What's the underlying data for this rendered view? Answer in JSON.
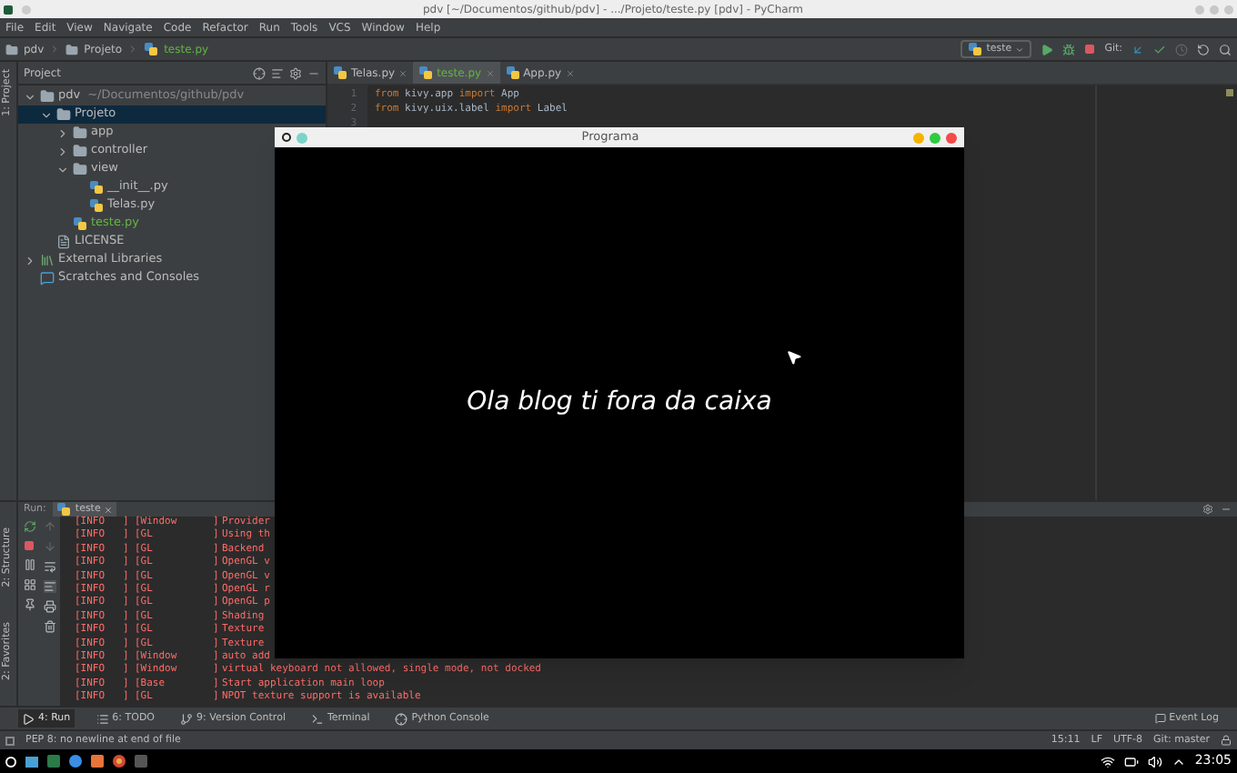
{
  "window": {
    "title": "pdv [~/Documentos/github/pdv] - .../Projeto/teste.py [pdv] - PyCharm"
  },
  "menu": [
    "File",
    "Edit",
    "View",
    "Navigate",
    "Code",
    "Refactor",
    "Run",
    "Tools",
    "VCS",
    "Window",
    "Help"
  ],
  "breadcrumb": [
    "pdv",
    "Projeto",
    "teste.py"
  ],
  "toolbar": {
    "run_config": "teste",
    "git_label": "Git:"
  },
  "left_strip": [
    "1: Project",
    "2: Structure",
    "2: Favorites"
  ],
  "project": {
    "title": "Project",
    "tree": [
      {
        "label": "pdv",
        "path": "~/Documentos/github/pdv",
        "kind": "folder",
        "expanded": true,
        "selected": false,
        "children": [
          {
            "label": "Projeto",
            "kind": "folder",
            "expanded": true,
            "selected": true,
            "children": [
              {
                "label": "app",
                "kind": "folder",
                "expanded": false,
                "selected": false
              },
              {
                "label": "controller",
                "kind": "folder",
                "expanded": false,
                "selected": false
              },
              {
                "label": "view",
                "kind": "folder",
                "expanded": true,
                "selected": false,
                "children": [
                  {
                    "label": "__init__.py",
                    "kind": "python",
                    "selected": false
                  },
                  {
                    "label": "Telas.py",
                    "kind": "python",
                    "selected": false
                  }
                ]
              },
              {
                "label": "teste.py",
                "kind": "python",
                "added": true,
                "selected": false
              }
            ]
          },
          {
            "label": "LICENSE",
            "kind": "file",
            "selected": false
          }
        ]
      },
      {
        "label": "External Libraries",
        "kind": "library",
        "expanded": false,
        "selected": false
      },
      {
        "label": "Scratches and Consoles",
        "kind": "scratch",
        "selected": false
      }
    ]
  },
  "editor": {
    "tabs": [
      {
        "label": "Telas.py",
        "selected": false
      },
      {
        "label": "teste.py",
        "selected": true
      },
      {
        "label": "App.py",
        "selected": false
      }
    ],
    "lines": [
      {
        "number": "1",
        "tokens": [
          {
            "text": "from",
            "kind": "keyword"
          },
          {
            "text": " kivy.app ",
            "kind": "plain"
          },
          {
            "text": "import",
            "kind": "keyword"
          },
          {
            "text": " App",
            "kind": "plain"
          }
        ]
      },
      {
        "number": "2",
        "tokens": [
          {
            "text": "from",
            "kind": "keyword"
          },
          {
            "text": " kivy.uix.label ",
            "kind": "plain"
          },
          {
            "text": "import",
            "kind": "keyword"
          },
          {
            "text": " Label",
            "kind": "plain"
          }
        ]
      },
      {
        "number": "3"
      }
    ]
  },
  "app_window": {
    "title": "Programa",
    "label": "Ola blog ti fora da caixa"
  },
  "run": {
    "title": "Run:",
    "tab": "teste",
    "log": [
      {
        "level": "[INFO   ]",
        "source": "[Window      ]",
        "message": "Provider"
      },
      {
        "level": "[INFO   ]",
        "source": "[GL          ]",
        "message": "Using th"
      },
      {
        "level": "[INFO   ]",
        "source": "[GL          ]",
        "message": "Backend"
      },
      {
        "level": "[INFO   ]",
        "source": "[GL          ]",
        "message": "OpenGL v"
      },
      {
        "level": "[INFO   ]",
        "source": "[GL          ]",
        "message": "OpenGL v"
      },
      {
        "level": "[INFO   ]",
        "source": "[GL          ]",
        "message": "OpenGL r"
      },
      {
        "level": "[INFO   ]",
        "source": "[GL          ]",
        "message": "OpenGL p"
      },
      {
        "level": "[INFO   ]",
        "source": "[GL          ]",
        "message": "Shading"
      },
      {
        "level": "[INFO   ]",
        "source": "[GL          ]",
        "message": "Texture"
      },
      {
        "level": "[INFO   ]",
        "source": "[GL          ]",
        "message": "Texture"
      },
      {
        "level": "[INFO   ]",
        "source": "[Window      ]",
        "message": "auto add"
      },
      {
        "level": "[INFO   ]",
        "source": "[Window      ]",
        "message": "virtual keyboard not allowed, single mode, not docked"
      },
      {
        "level": "[INFO   ]",
        "source": "[Base        ]",
        "message": "Start application main loop"
      },
      {
        "level": "[INFO   ]",
        "source": "[GL          ]",
        "message": "NPOT texture support is available"
      }
    ]
  },
  "tool_buttons": [
    {
      "label": "4: Run",
      "kind": "run",
      "selected": true
    },
    {
      "label": "6: TODO",
      "kind": "todo",
      "selected": false
    },
    {
      "label": "9: Version Control",
      "kind": "vcs",
      "selected": false
    },
    {
      "label": "Terminal",
      "kind": "terminal",
      "selected": false
    },
    {
      "label": "Python Console",
      "kind": "console",
      "selected": false
    }
  ],
  "event_log": "Event Log",
  "status_bar": {
    "message": "PEP 8: no newline at end of file",
    "position": "15:11",
    "line_sep": "LF",
    "encoding": "UTF-8",
    "branch": "Git: master"
  },
  "taskbar": {
    "clock": "23:05"
  }
}
